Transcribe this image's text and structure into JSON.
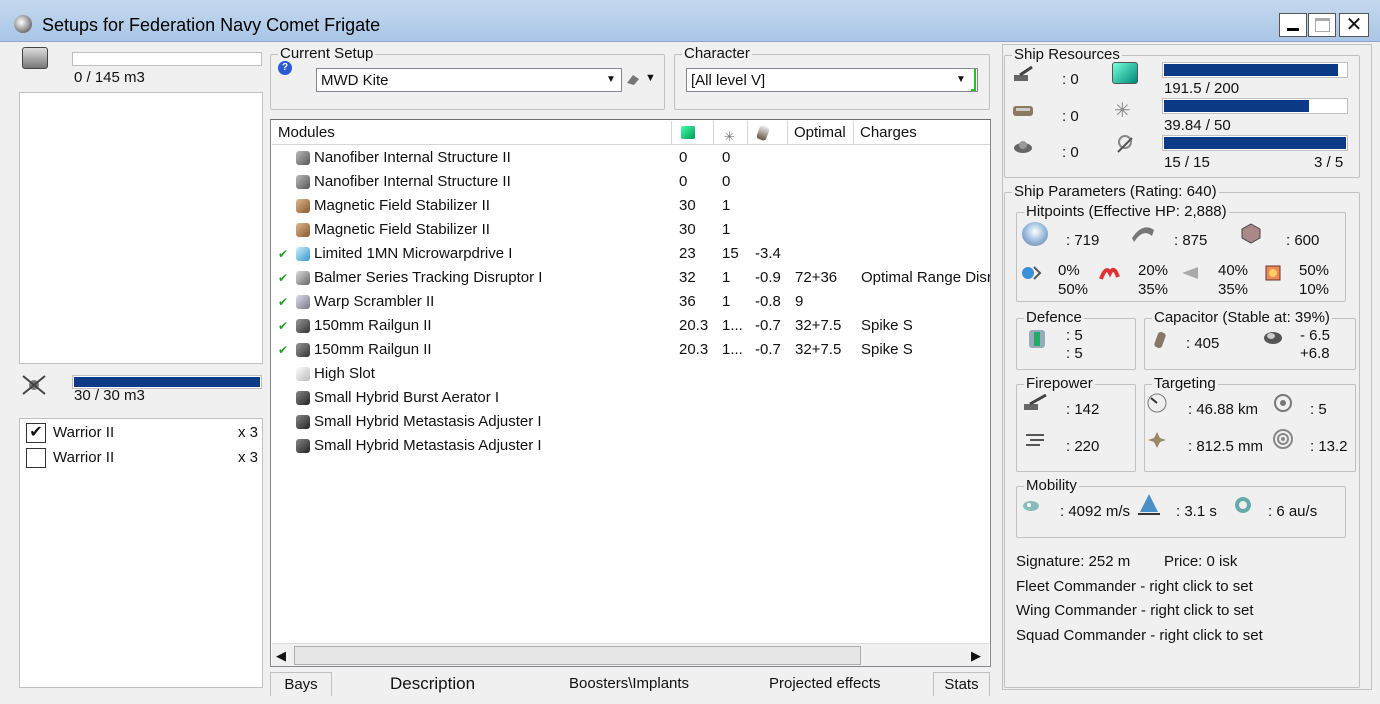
{
  "window": {
    "title": "Setups for Federation Navy Comet Frigate"
  },
  "cargo": {
    "capacity_text": "0 / 145 m3",
    "fill_fraction": 0.0
  },
  "drones": {
    "capacity_text": "30 / 30 m3",
    "fill_fraction": 1.0,
    "items": [
      {
        "checked": true,
        "name": "Warrior II",
        "qty": "x 3"
      },
      {
        "checked": false,
        "name": "Warrior II",
        "qty": "x 3"
      }
    ]
  },
  "setup": {
    "legend": "Current Setup",
    "value": "MWD Kite"
  },
  "character": {
    "legend": "Character",
    "value": "[All level V]"
  },
  "modules": {
    "headers": {
      "name": "Modules",
      "optimal": "Optimal",
      "charges": "Charges"
    },
    "rows": [
      {
        "active": false,
        "icon": "structure-icon",
        "name": "Nanofiber Internal Structure II",
        "cpu": "0",
        "pg": "0",
        "cap": "",
        "optimal": "",
        "charges": ""
      },
      {
        "active": false,
        "icon": "structure-icon",
        "name": "Nanofiber Internal Structure II",
        "cpu": "0",
        "pg": "0",
        "cap": "",
        "optimal": "",
        "charges": ""
      },
      {
        "active": false,
        "icon": "stabilizer-icon",
        "name": "Magnetic Field Stabilizer II",
        "cpu": "30",
        "pg": "1",
        "cap": "",
        "optimal": "",
        "charges": ""
      },
      {
        "active": false,
        "icon": "stabilizer-icon",
        "name": "Magnetic Field Stabilizer II",
        "cpu": "30",
        "pg": "1",
        "cap": "",
        "optimal": "",
        "charges": ""
      },
      {
        "active": true,
        "icon": "microwarpdrive-icon",
        "name": "Limited 1MN Microwarpdrive I",
        "cpu": "23",
        "pg": "15",
        "cap": "-3.4",
        "optimal": "",
        "charges": ""
      },
      {
        "active": true,
        "icon": "tracking-disruptor-icon",
        "name": "Balmer Series Tracking Disruptor I",
        "cpu": "32",
        "pg": "1",
        "cap": "-0.9",
        "optimal": "72+36",
        "charges": "Optimal Range Disruption Script"
      },
      {
        "active": true,
        "icon": "warp-scrambler-icon",
        "name": "Warp Scrambler II",
        "cpu": "36",
        "pg": "1",
        "cap": "-0.8",
        "optimal": "9",
        "charges": ""
      },
      {
        "active": true,
        "icon": "railgun-icon",
        "name": "150mm Railgun II",
        "cpu": "20.3",
        "pg": "1...",
        "cap": "-0.7",
        "optimal": "32+7.5",
        "charges": "Spike S"
      },
      {
        "active": true,
        "icon": "railgun-icon",
        "name": "150mm Railgun II",
        "cpu": "20.3",
        "pg": "1...",
        "cap": "-0.7",
        "optimal": "32+7.5",
        "charges": "Spike S"
      },
      {
        "active": false,
        "icon": "high-slot-icon",
        "name": "High Slot",
        "cpu": "",
        "pg": "",
        "cap": "",
        "optimal": "",
        "charges": ""
      },
      {
        "active": false,
        "icon": "rig-icon",
        "name": "Small Hybrid Burst Aerator I",
        "cpu": "",
        "pg": "",
        "cap": "",
        "optimal": "",
        "charges": ""
      },
      {
        "active": false,
        "icon": "rig-icon",
        "name": "Small Hybrid Metastasis Adjuster I",
        "cpu": "",
        "pg": "",
        "cap": "",
        "optimal": "",
        "charges": ""
      },
      {
        "active": false,
        "icon": "rig-icon",
        "name": "Small Hybrid Metastasis Adjuster I",
        "cpu": "",
        "pg": "",
        "cap": "",
        "optimal": "",
        "charges": ""
      }
    ]
  },
  "tabs": [
    "Bays",
    "Description",
    "Boosters\\Implants",
    "Projected effects",
    "Stats"
  ],
  "resources": {
    "legend": "Ship Resources",
    "slots": {
      "turret": ": 0",
      "launcher": ": 0",
      "calibration": ": 0"
    },
    "cpu": {
      "text": "191.5 / 200",
      "fraction": 0.9575
    },
    "powergrid": {
      "text": "39.84 / 50",
      "fraction": 0.7968
    },
    "drones_bw": {
      "text": "15 / 15",
      "fraction": 1.0
    },
    "drones_active": "3 / 5"
  },
  "params": {
    "legend": "Ship Parameters (Rating: 640)",
    "hitpoints": {
      "legend": "Hitpoints (Effective HP: 2,888)",
      "shield": ": 719",
      "armor": ": 875",
      "structure": ": 600",
      "em": [
        "0%",
        "50%"
      ],
      "thermal": [
        "20%",
        "35%"
      ],
      "kinetic": [
        "40%",
        "35%"
      ],
      "explosive": [
        "50%",
        "10%"
      ]
    },
    "defence": {
      "legend": "Defence",
      "a": ": 5",
      "b": ": 5"
    },
    "capacitor": {
      "legend": "Capacitor (Stable at: 39%)",
      "amount": ": 405",
      "delta_a": "- 6.5",
      "delta_b": "+6.8"
    },
    "firepower": {
      "legend": "Firepower",
      "turret": ": 142",
      "volley": ": 220"
    },
    "targeting": {
      "legend": "Targeting",
      "range": ": 46.88 km",
      "targets": ": 5",
      "resolution": ": 812.5 mm",
      "strength": ": 13.2"
    },
    "mobility": {
      "legend": "Mobility",
      "speed": ": 4092 m/s",
      "align": ": 3.1 s",
      "warp": ": 6 au/s"
    },
    "signature": "Signature: 252 m",
    "price": "Price: 0 isk",
    "fleet": "Fleet Commander - right click to set",
    "wing": "Wing Commander - right click to set",
    "squad": "Squad Commander - right click to set"
  }
}
